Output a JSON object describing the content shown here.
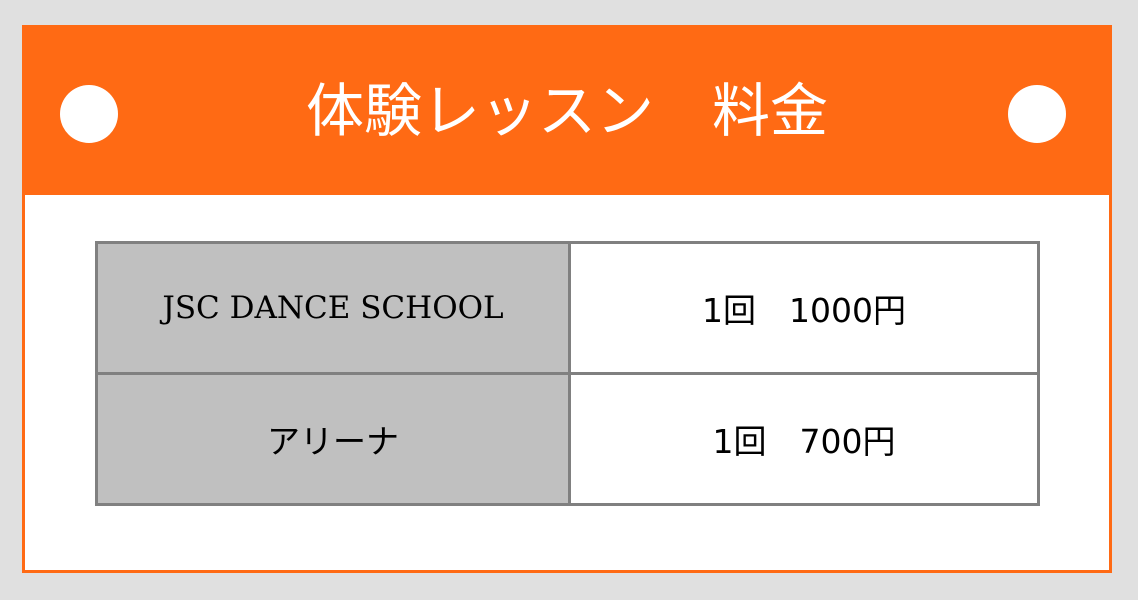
{
  "header": {
    "title": "体験レッスン　料金",
    "color": "#ff6a14"
  },
  "price_table": {
    "rows": [
      {
        "label": "JSC DANCE SCHOOL",
        "value": "1回　1000円"
      },
      {
        "label": "アリーナ",
        "value": "1回　700円"
      }
    ]
  },
  "colors": {
    "label_cell_bg": "#c0c0c0",
    "border": "#808080",
    "accent": "#ff6a14"
  }
}
